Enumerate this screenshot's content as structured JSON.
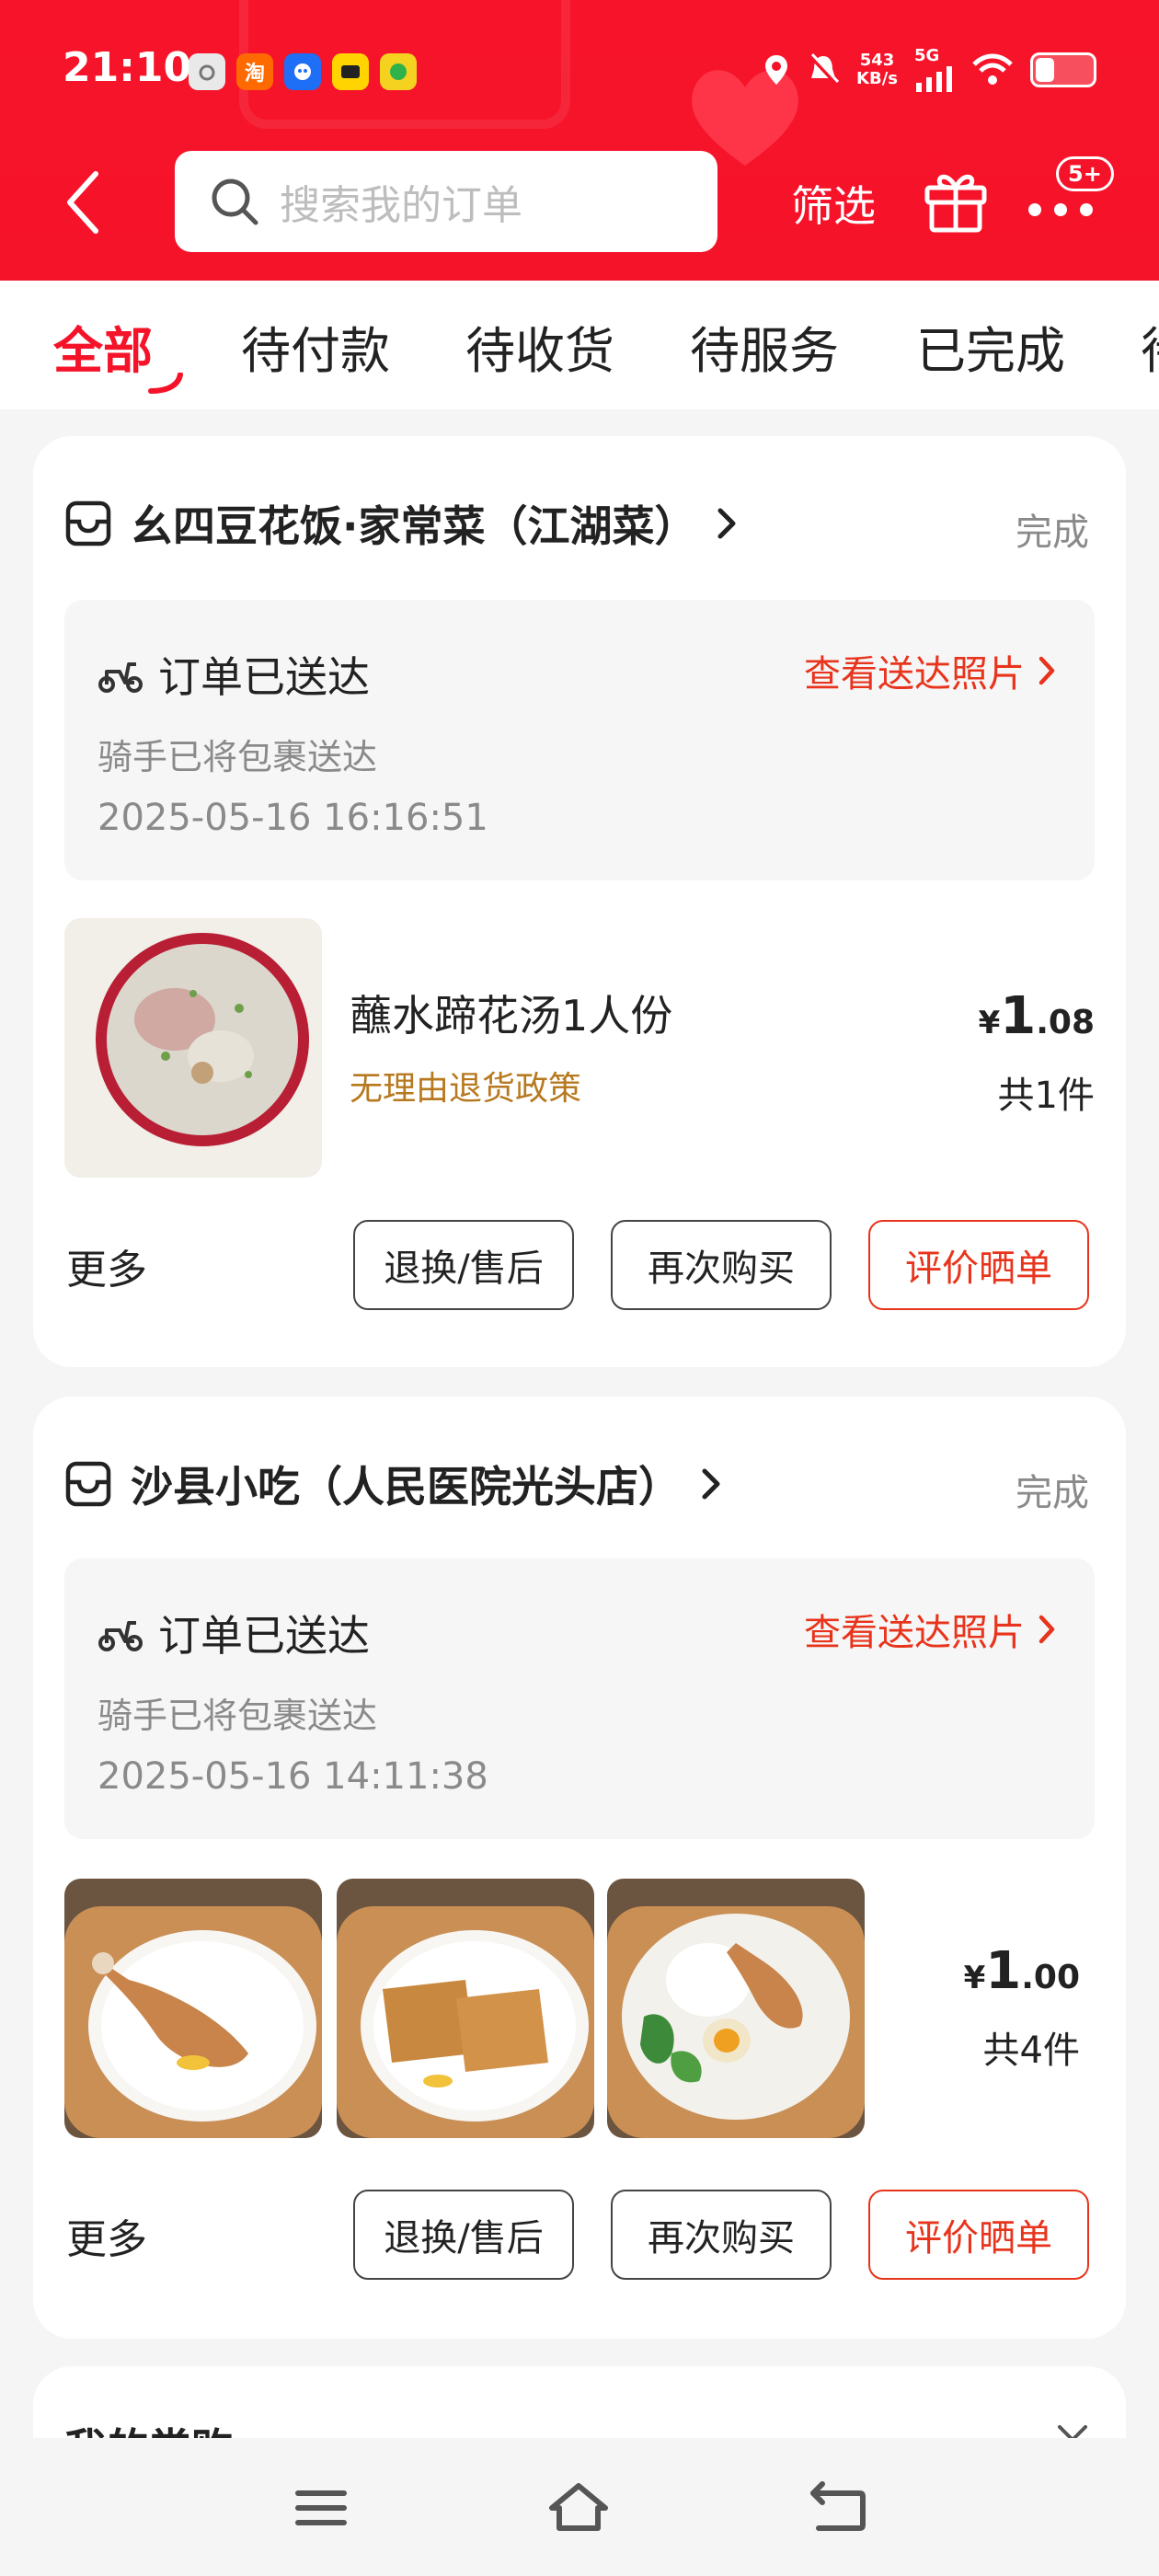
{
  "status_bar": {
    "time": "21:10",
    "net_speed_value": "543",
    "net_speed_unit": "KB/s",
    "signal_label": "5G"
  },
  "header": {
    "search_placeholder": "搜索我的订单",
    "filter_label": "筛选",
    "more_badge": "5+"
  },
  "tabs": [
    "全部",
    "待付款",
    "待收货",
    "待服务",
    "已完成",
    "待"
  ],
  "orders": [
    {
      "shop_name": "幺四豆花饭·家常菜（江湖菜）",
      "status": "完成",
      "delivery_title": "订单已送达",
      "delivery_photo_link": "查看送达照片",
      "delivery_sub": "骑手已将包裹送达",
      "delivery_time": "2025-05-16 16:16:51",
      "item_name": "蘸水蹄花汤1人份",
      "item_policy": "无理由退货政策",
      "price_symbol": "¥",
      "price_int": "1",
      "price_dec": ".08",
      "quantity": "共1件",
      "more_label": "更多",
      "buttons": [
        "退换/售后",
        "再次购买",
        "评价晒单"
      ]
    },
    {
      "shop_name": "沙县小吃（人民医院光头店）",
      "status": "完成",
      "delivery_title": "订单已送达",
      "delivery_photo_link": "查看送达照片",
      "delivery_sub": "骑手已将包裹送达",
      "delivery_time": "2025-05-16 14:11:38",
      "price_symbol": "¥",
      "price_int": "1",
      "price_dec": ".00",
      "quantity": "共4件",
      "more_label": "更多",
      "buttons": [
        "退换/售后",
        "再次购买",
        "评价晒单"
      ]
    }
  ],
  "frequent": {
    "title": "我的常购"
  },
  "colors": {
    "brand_red": "#f5132a",
    "link_red": "#e8341c",
    "policy_gold": "#b7791f"
  }
}
